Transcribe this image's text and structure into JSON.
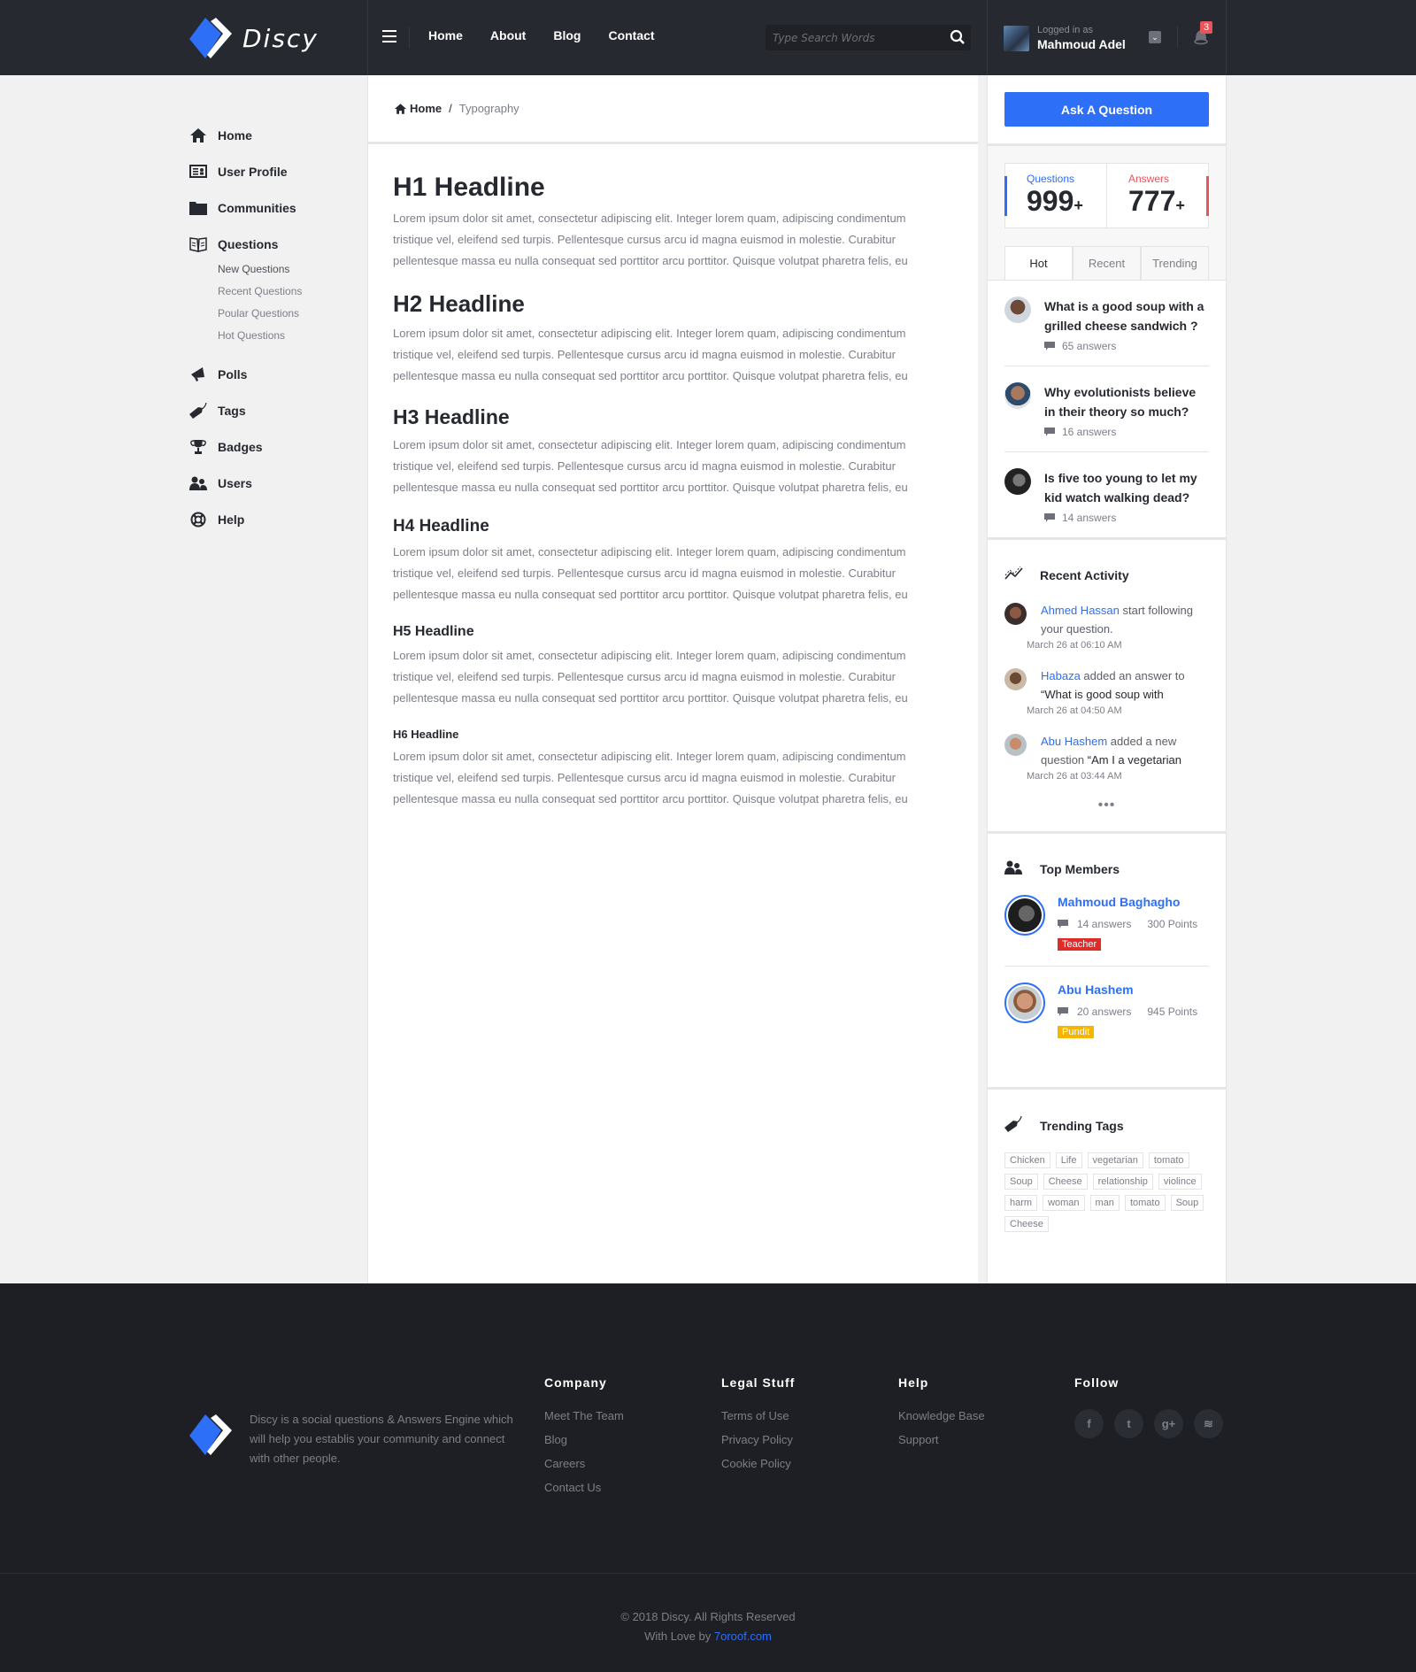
{
  "brand": {
    "name": "Discy",
    "accent": "#2d6ff7",
    "danger": "#e9545a"
  },
  "header": {
    "nav": [
      "Home",
      "About",
      "Blog",
      "Contact"
    ],
    "search_placeholder": "Type Search Words",
    "user": {
      "label": "Logged in as",
      "name": "Mahmoud Adel"
    },
    "notifications": "3"
  },
  "sidebar": {
    "items": [
      {
        "label": "Home",
        "icon": "home-icon"
      },
      {
        "label": "User Profile",
        "icon": "id-card-icon"
      },
      {
        "label": "Communities",
        "icon": "folder-icon"
      },
      {
        "label": "Questions",
        "icon": "book-icon"
      },
      {
        "label": "Polls",
        "icon": "megaphone-icon"
      },
      {
        "label": "Tags",
        "icon": "tag-icon"
      },
      {
        "label": "Badges",
        "icon": "trophy-icon"
      },
      {
        "label": "Users",
        "icon": "users-icon"
      },
      {
        "label": "Help",
        "icon": "lifebuoy-icon"
      }
    ],
    "sub_items": [
      "New Questions",
      "Recent Questions",
      "Poular Questions",
      "Hot Questions"
    ]
  },
  "breadcrumb": {
    "home": "Home",
    "separator": "/",
    "current": "Typography"
  },
  "typography": {
    "headlines": [
      "H1 Headline",
      "H2 Headline",
      "H3 Headline",
      "H4 Headline",
      "H5 Headline",
      "H6 Headline"
    ],
    "paragraph_lines": [
      "Lorem ipsum dolor sit amet, consectetur adipiscing elit. Integer lorem quam, adipiscing condimentum",
      "tristique vel, eleifend sed turpis. Pellentesque cursus arcu id magna euismod in molestie. Curabitur",
      "pellentesque massa eu nulla consequat sed porttitor arcu porttitor. Quisque volutpat pharetra felis, eu"
    ]
  },
  "right": {
    "ask_button": "Ask A Question",
    "stats": {
      "questions_label": "Questions",
      "questions_value": "999",
      "answers_label": "Answers",
      "answers_value": "777",
      "plus": "+"
    },
    "tabs": [
      "Hot",
      "Recent",
      "Trending"
    ],
    "questions": [
      {
        "title": "What is a good soup with a grilled cheese sandwich ?",
        "answers": "65 answers"
      },
      {
        "title": "Why evolutionists believe in their theory so much?",
        "answers": "16 answers"
      },
      {
        "title": "Is five too young to let my kid watch walking dead?",
        "answers": "14 answers"
      }
    ],
    "recent_activity": {
      "title": "Recent Activity",
      "items": [
        {
          "who": "Ahmed Hassan",
          "action": " start following your question.",
          "quote": "",
          "time": "March 26 at 06:10 AM"
        },
        {
          "who": "Habaza",
          "action": " added an answer to ",
          "quote": "“What is  good soup with",
          "time": "March 26 at 04:50 AM"
        },
        {
          "who": "Abu Hashem",
          "action": " added a new question ",
          "quote": "“Am I a vegetarian",
          "time": "March 26 at 03:44 AM"
        }
      ],
      "more": "•••"
    },
    "top_members": {
      "title": "Top Members",
      "members": [
        {
          "name": "Mahmoud Baghagho",
          "answers": "14 answers",
          "points": "300 Points",
          "role": "Teacher",
          "role_color": "#e02b2b"
        },
        {
          "name": "Abu Hashem",
          "answers": "20 answers",
          "points": "945 Points",
          "role": "Pundit",
          "role_color": "#f6b500"
        }
      ]
    },
    "trending_tags": {
      "title": "Trending Tags",
      "tags": [
        "Chicken",
        "Life",
        "vegetarian",
        "tomato",
        "Soup",
        "Cheese",
        "relationship",
        "violince",
        "harm",
        "woman",
        "man",
        "tomato",
        "Soup",
        "Cheese"
      ]
    }
  },
  "footer": {
    "about": "Discy is a social questions & Answers Engine which will help you establis your community and connect with other people.",
    "columns": [
      {
        "title": "Company",
        "links": [
          "Meet The Team",
          "Blog",
          "Careers",
          "Contact Us"
        ]
      },
      {
        "title": "Legal Stuff",
        "links": [
          "Terms of Use",
          "Privacy Policy",
          "Cookie Policy"
        ]
      },
      {
        "title": "Help",
        "links": [
          "Knowledge Base",
          "Support"
        ]
      }
    ],
    "follow": {
      "title": "Follow",
      "icons": [
        "facebook-icon",
        "twitter-icon",
        "google-plus-icon",
        "rss-icon"
      ],
      "glyphs": [
        "f",
        "t",
        "g+",
        "≋"
      ]
    },
    "copyright": "© 2018 Discy. All Rights Reserved",
    "credit_prefix": "With Love by ",
    "credit_link": "7oroof.com"
  }
}
